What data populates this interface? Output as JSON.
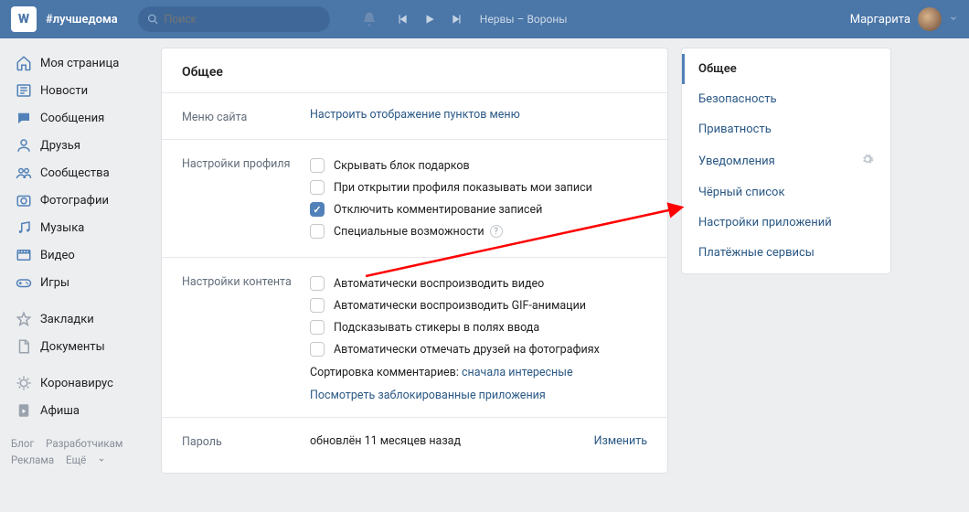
{
  "topbar": {
    "slogan": "#лучшедома",
    "search_placeholder": "Поиск",
    "track": "Нервы – Вороны",
    "username": "Маргарита"
  },
  "nav": {
    "items": [
      {
        "icon": "home",
        "label": "Моя страница"
      },
      {
        "icon": "news",
        "label": "Новости"
      },
      {
        "icon": "msg",
        "label": "Сообщения"
      },
      {
        "icon": "friends",
        "label": "Друзья"
      },
      {
        "icon": "group",
        "label": "Сообщества"
      },
      {
        "icon": "photo",
        "label": "Фотографии"
      },
      {
        "icon": "music",
        "label": "Музыка"
      },
      {
        "icon": "video",
        "label": "Видео"
      },
      {
        "icon": "game",
        "label": "Игры"
      }
    ],
    "items2": [
      {
        "icon": "star",
        "label": "Закладки"
      },
      {
        "icon": "doc",
        "label": "Документы"
      }
    ],
    "items3": [
      {
        "icon": "virus",
        "label": "Коронавирус"
      },
      {
        "icon": "poster",
        "label": "Афиша"
      }
    ]
  },
  "footer": {
    "blog": "Блог",
    "dev": "Разработчикам",
    "ads": "Реклама",
    "more": "Ещё"
  },
  "main": {
    "title": "Общее",
    "menu_site": {
      "label": "Меню сайта",
      "action": "Настроить отображение пунктов меню"
    },
    "profile": {
      "label": "Настройки профиля",
      "opts": [
        {
          "key": "hide_gifts",
          "text": "Скрывать блок подарков",
          "checked": false
        },
        {
          "key": "show_posts_on_open",
          "text": "При открытии профиля показывать мои записи",
          "checked": false
        },
        {
          "key": "disable_comments",
          "text": "Отключить комментирование записей",
          "checked": true
        },
        {
          "key": "accessibility",
          "text": "Специальные возможности",
          "checked": false,
          "help": true
        }
      ]
    },
    "content": {
      "label": "Настройки контента",
      "opts": [
        {
          "key": "autoplay_video",
          "text": "Автоматически воспроизводить видео",
          "checked": false
        },
        {
          "key": "autoplay_gif",
          "text": "Автоматически воспроизводить GIF-анимации",
          "checked": false
        },
        {
          "key": "suggest_stickers",
          "text": "Подсказывать стикеры в полях ввода",
          "checked": false
        },
        {
          "key": "auto_tag",
          "text": "Автоматически отмечать друзей на фотографиях",
          "checked": false
        }
      ],
      "sort_label": "Сортировка комментариев:",
      "sort_value": "сначала интересные",
      "blocked_apps": "Посмотреть заблокированные приложения"
    },
    "password": {
      "label": "Пароль",
      "status": "обновлён 11 месяцев назад",
      "change": "Изменить"
    }
  },
  "right": {
    "items": [
      {
        "label": "Общее",
        "active": true
      },
      {
        "label": "Безопасность"
      },
      {
        "label": "Приватность"
      },
      {
        "label": "Уведомления",
        "gear": true
      },
      {
        "label": "Чёрный список"
      },
      {
        "label": "Настройки приложений"
      },
      {
        "label": "Платёжные сервисы"
      }
    ]
  }
}
